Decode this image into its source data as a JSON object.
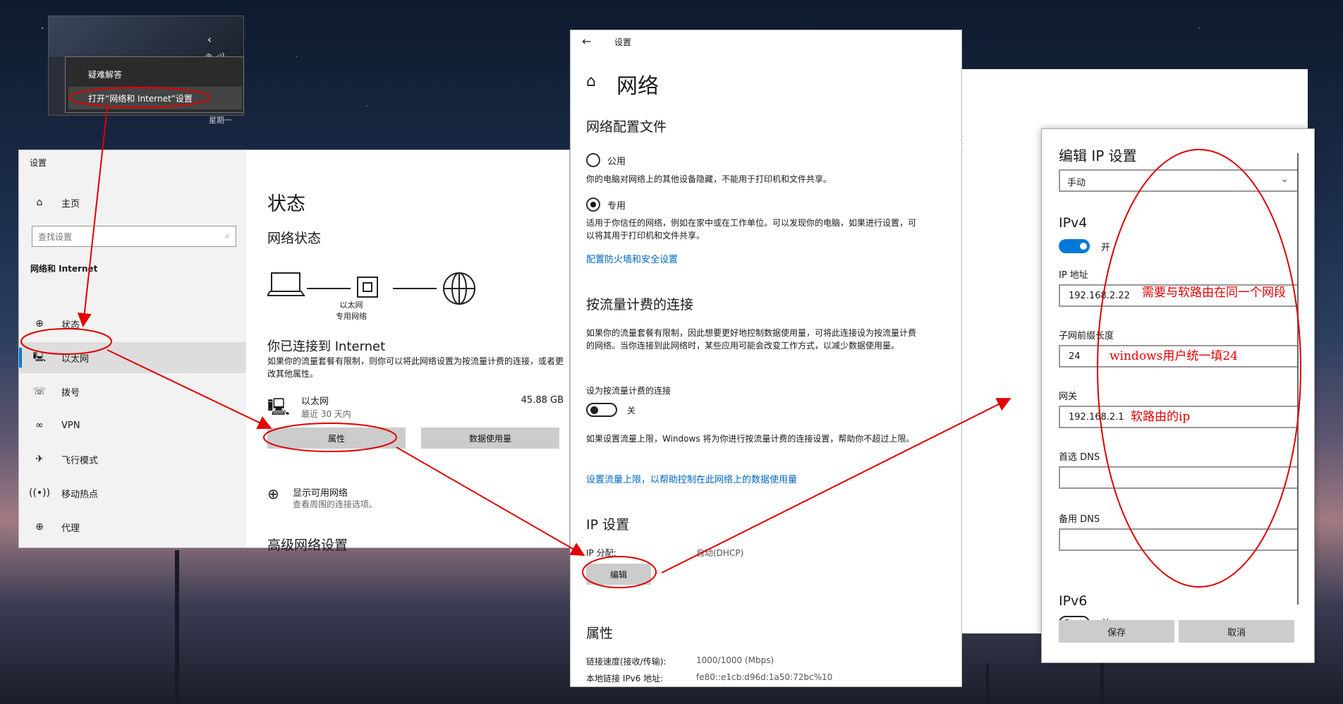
{
  "tray": {
    "context_items": [
      "疑难解答",
      "打开“网络和 Internet”设置"
    ],
    "date_partial": "星期一"
  },
  "settings_left": {
    "window_title": "设置",
    "home": "主页",
    "search_placeholder": "查找设置",
    "section": "网络和 Internet",
    "nav": [
      {
        "label": "状态",
        "icon": "status-icon"
      },
      {
        "label": "以太网",
        "icon": "ethernet-icon"
      },
      {
        "label": "拨号",
        "icon": "dialup-icon"
      },
      {
        "label": "VPN",
        "icon": "vpn-icon"
      },
      {
        "label": "飞行模式",
        "icon": "airplane-icon"
      },
      {
        "label": "移动热点",
        "icon": "hotspot-icon"
      },
      {
        "label": "代理",
        "icon": "globe-icon"
      }
    ],
    "selected_index": 1,
    "status_title": "状态",
    "net_status": "网络状态",
    "diagram_label1": "以太网",
    "diagram_label2": "专用网络",
    "connected": "你已连接到 Internet",
    "connected_desc": "如果你的流量套餐有限制，则你可以将此网络设置为按流量计费的连接，或者更改其他属性。",
    "eth_name": "以太网",
    "eth_sub": "最近 30 天内",
    "eth_size": "45.88 GB",
    "btn_properties": "属性",
    "btn_data_usage": "数据使用量",
    "show_networks": "显示可用网络",
    "show_networks_sub": "查看周围的连接选项。",
    "advanced": "高级网络设置"
  },
  "settings_mid": {
    "window_title": "设置",
    "page_title": "网络",
    "profile_section": "网络配置文件",
    "public": "公用",
    "public_desc": "你的电脑对网络上的其他设备隐藏，不能用于打印机和文件共享。",
    "private": "专用",
    "private_desc": "适用于你信任的网络，例如在家中或在工作单位。可以发现你的电脑，如果进行设置，可以将其用于打印机和文件共享。",
    "firewall_link": "配置防火墙和安全设置",
    "metered_section": "按流量计费的连接",
    "metered_desc": "如果你的流量套餐有限制，因此想要更好地控制数据使用量，可将此连接设为按流量计费的网络。当你连接到此网络时，某些应用可能会改变工作方式，以减少数据使用量。",
    "metered_toggle_label": "设为按流量计费的连接",
    "metered_toggle_state": "关",
    "limit_desc": "如果设置流量上限，Windows 将为你进行按流量计费的连接设置，帮助你不超过上限。",
    "limit_link": "设置流量上限，以帮助控制在此网络上的数据使用量",
    "ip_section": "IP 设置",
    "ip_assign_label": "IP 分配:",
    "ip_assign_value": "自动(DHCP)",
    "edit_button": "编辑",
    "props_section": "属性",
    "link_speed_label": "链接速度(接收/传输):",
    "link_speed_value": "1000/1000 (Mbps)",
    "ipv6_label": "本地链接 IPv6 地址:",
    "ipv6_value": "fe80::e1cb:d96d:1a50:72bc%10"
  },
  "dialog": {
    "title": "编辑 IP 设置",
    "mode": "手动",
    "ipv4": "IPv4",
    "ipv4_state": "开",
    "ip_label": "IP 地址",
    "ip_value": "192.168.2.22",
    "prefix_label": "子网前缀长度",
    "prefix_value": "24",
    "gateway_label": "网关",
    "gateway_value": "192.168.2.1",
    "dns1_label": "首选 DNS",
    "dns2_label": "备用 DNS",
    "ipv6": "IPv6",
    "ipv6_state": "关",
    "save": "保存",
    "cancel": "取消"
  },
  "annotations": {
    "ip_note": "需要与软路由在同一个网段",
    "prefix_note": "windows用户统一填24",
    "gateway_note": "软路由的ip"
  },
  "colors": {
    "accent": "#0078d7",
    "annotation": "#e00000",
    "link": "#0067c0"
  }
}
